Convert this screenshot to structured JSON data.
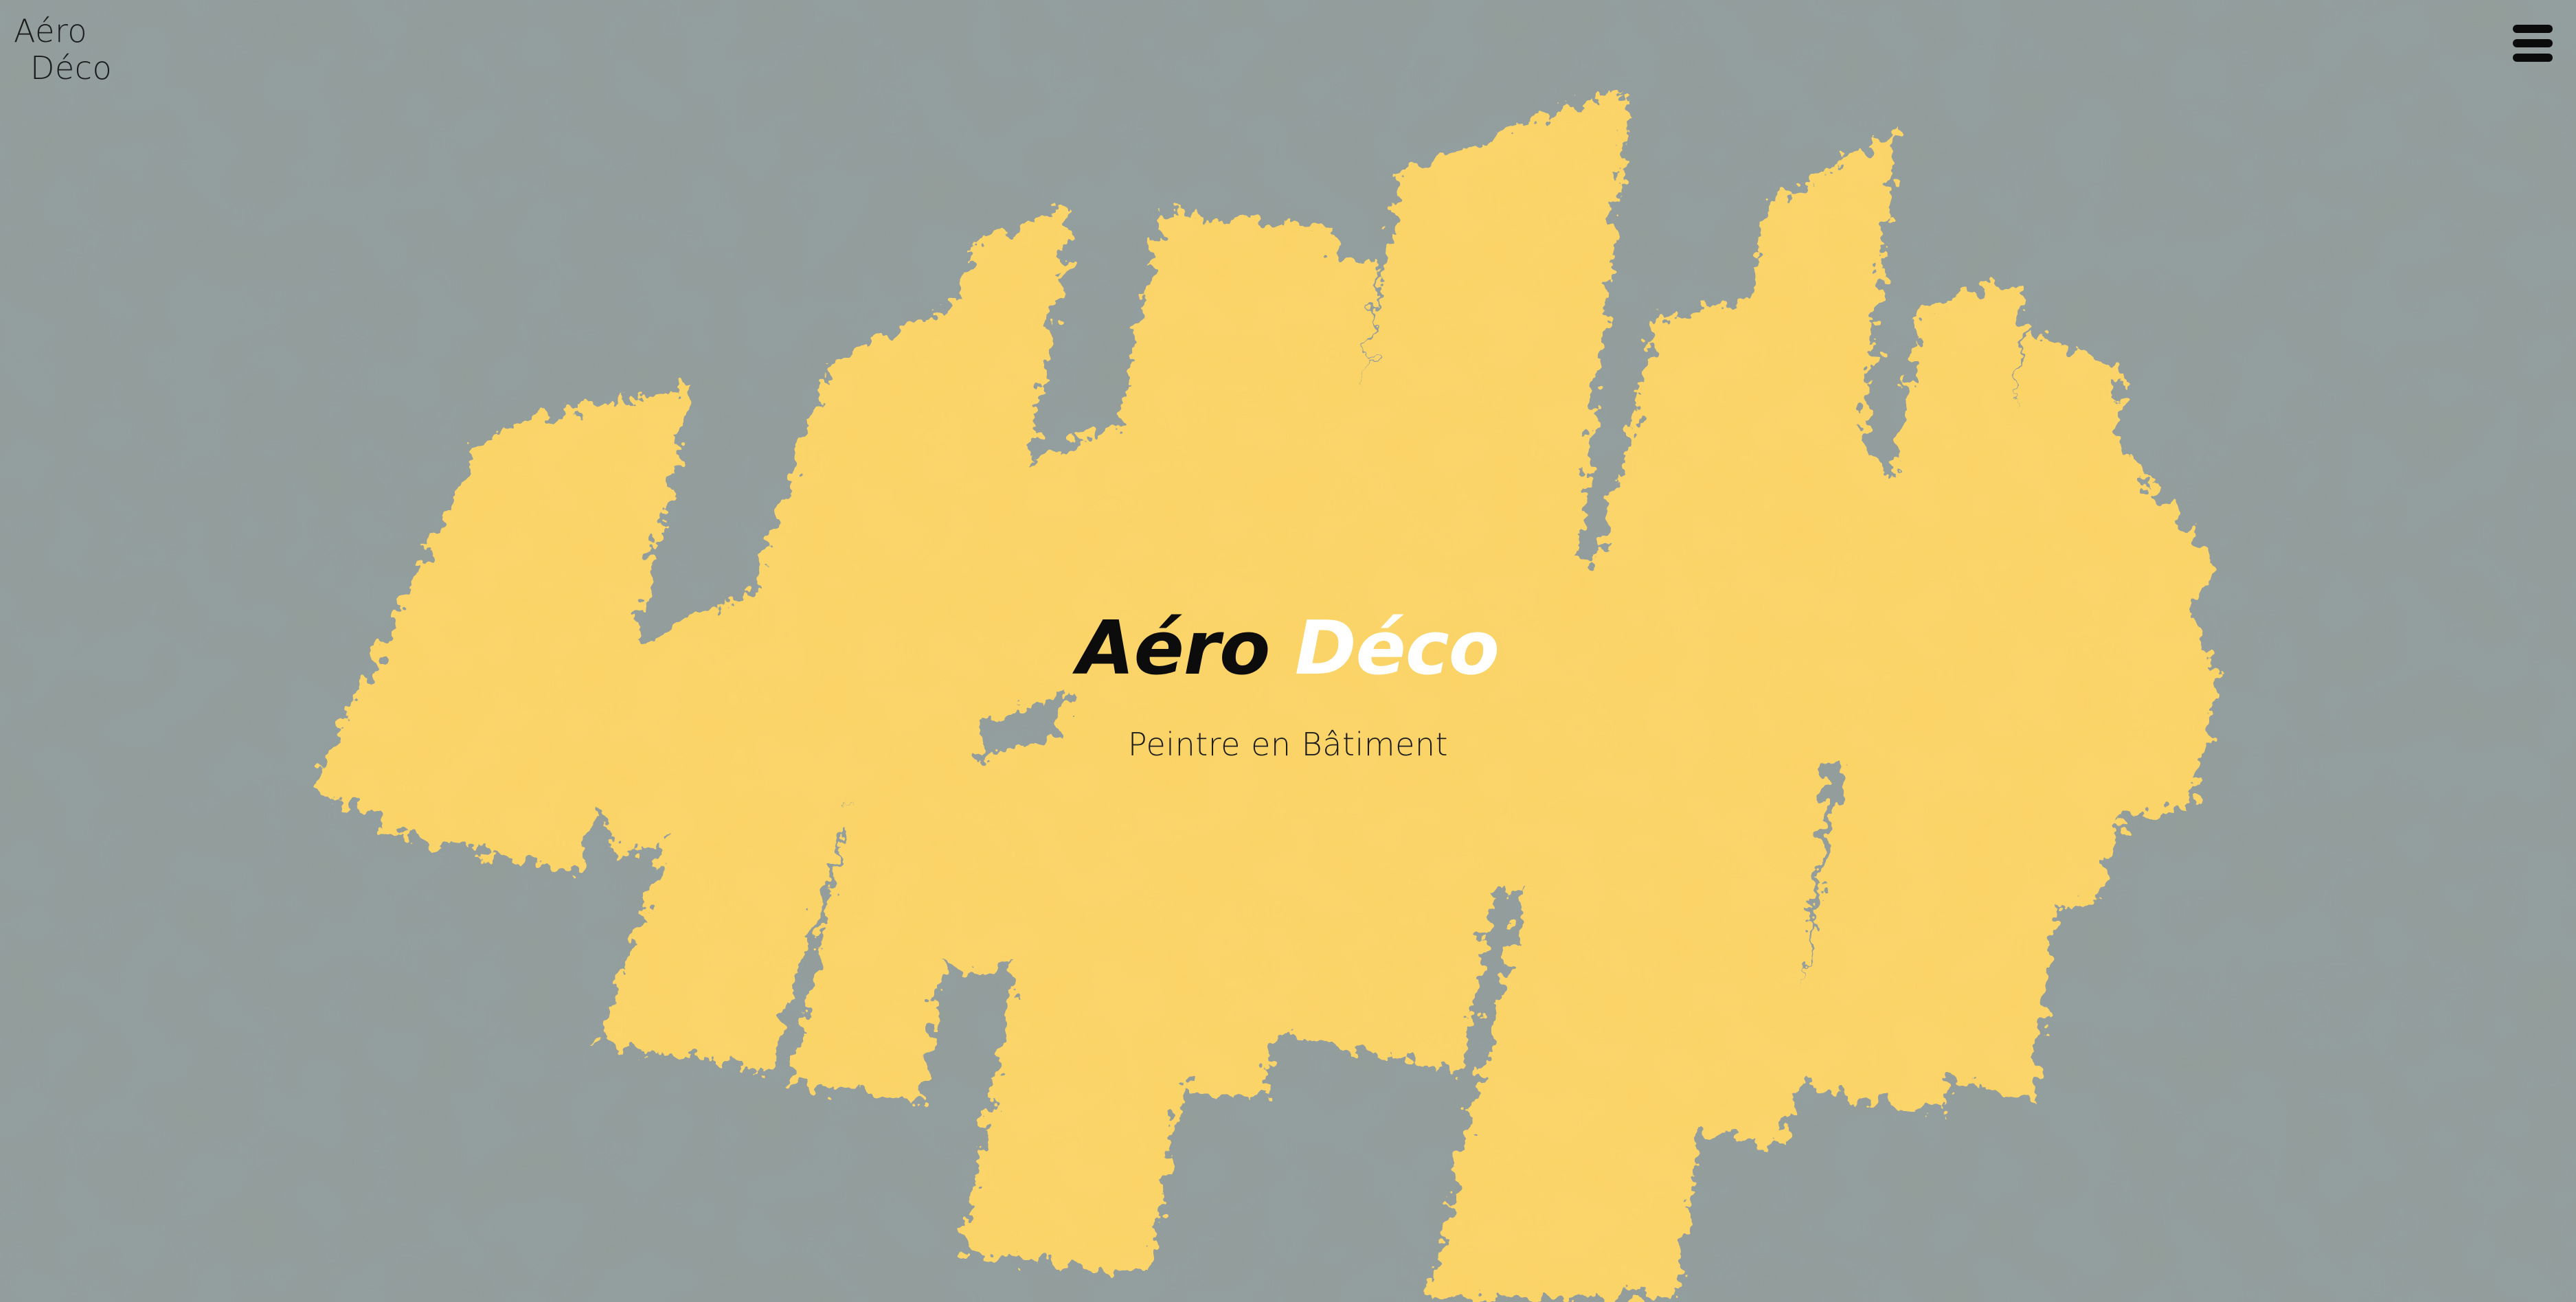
{
  "header": {
    "logo_line1": "Aéro",
    "logo_line2": "Déco",
    "menu_icon": "hamburger-menu-icon"
  },
  "hero": {
    "title_word1": "Aéro",
    "title_word2": "Déco",
    "subtitle": "Peintre en Bâtiment"
  },
  "colors": {
    "background": "#939e9f",
    "paint": "#fbd56a",
    "title_dark": "#0c0c0c",
    "title_light": "#ffffff"
  }
}
